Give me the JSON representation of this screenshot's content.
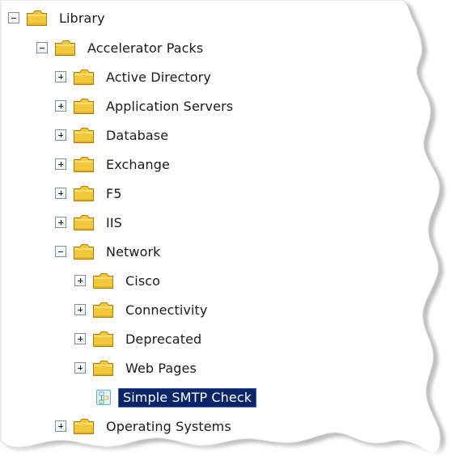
{
  "tree": {
    "items": [
      {
        "label": "Library",
        "toggle": "minus"
      },
      {
        "label": "Accelerator Packs",
        "toggle": "minus"
      },
      {
        "label": "Active Directory",
        "toggle": "plus"
      },
      {
        "label": "Application Servers",
        "toggle": "plus"
      },
      {
        "label": "Database",
        "toggle": "plus"
      },
      {
        "label": "Exchange",
        "toggle": "plus"
      },
      {
        "label": "F5",
        "toggle": "plus"
      },
      {
        "label": "IIS",
        "toggle": "plus"
      },
      {
        "label": "Network",
        "toggle": "minus"
      },
      {
        "label": "Cisco",
        "toggle": "plus"
      },
      {
        "label": "Connectivity",
        "toggle": "plus"
      },
      {
        "label": "Deprecated",
        "toggle": "plus"
      },
      {
        "label": "Web Pages",
        "toggle": "plus"
      },
      {
        "label": "Simple SMTP Check",
        "selected": true
      },
      {
        "label": "Operating Systems",
        "toggle": "plus"
      }
    ]
  },
  "colors": {
    "selection_bg": "#0a246a",
    "selection_text": "#ffffff",
    "folder_fill": "#f2c93d",
    "folder_edge": "#b07c06"
  },
  "icons": {
    "folder": "folder-icon",
    "expand": "plus-icon",
    "collapse": "minus-icon",
    "monitor": "smtp-check-icon"
  }
}
